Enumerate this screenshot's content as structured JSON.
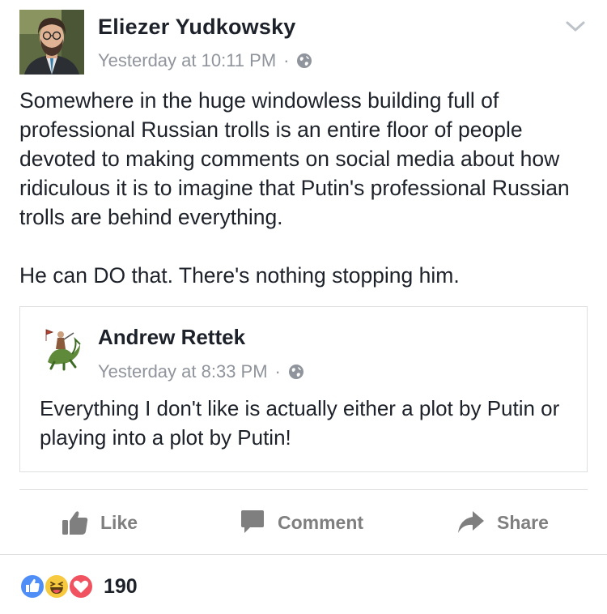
{
  "post": {
    "author": "Eliezer Yudkowsky",
    "timestamp": "Yesterday at 10:11 PM",
    "separator": "·",
    "audience_icon": "globe-icon",
    "menu_icon": "chevron-down-icon",
    "body_paragraphs": [
      "Somewhere in the huge windowless building full of professional Russian trolls is an entire floor of people devoted to making comments on social media about how ridiculous it is to imagine that Putin's professional Russian trolls are behind everything.",
      "He can DO that.  There's nothing stopping him."
    ]
  },
  "shared_post": {
    "author": "Andrew Rettek",
    "timestamp": "Yesterday at 8:33 PM",
    "separator": "·",
    "audience_icon": "globe-icon",
    "body": "Everything I don't like is actually either a plot by Putin or playing into a plot by Putin!"
  },
  "actions": {
    "like": "Like",
    "comment": "Comment",
    "share": "Share"
  },
  "reactions": {
    "types": [
      "like",
      "haha",
      "love"
    ],
    "count": "190"
  },
  "colors": {
    "text": "#1d2129",
    "meta": "#90949c",
    "action": "#7f7f7f",
    "like_blue": "#4f8ef7",
    "haha_yellow": "#f7c93e",
    "love_red": "#f0525f",
    "border": "#dddfe2"
  }
}
